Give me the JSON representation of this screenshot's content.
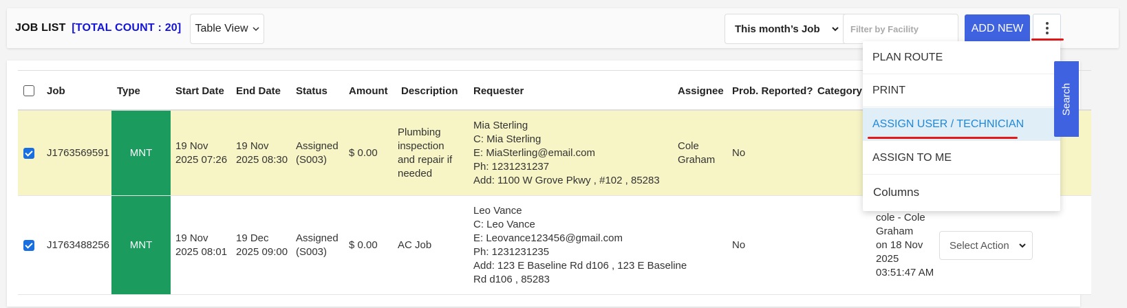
{
  "header": {
    "title": "JOB LIST",
    "count_label": "[TOTAL COUNT : 20]",
    "view_select": "Table View",
    "month_filter": "This month’s Job",
    "facility_placeholder": "Filter by Facility",
    "add_new": "ADD NEW"
  },
  "menu": {
    "items": [
      {
        "label": "PLAN ROUTE"
      },
      {
        "label": "PRINT"
      },
      {
        "label": "ASSIGN USER / TECHNICIAN"
      },
      {
        "label": "ASSIGN TO ME"
      },
      {
        "label": "Columns"
      }
    ]
  },
  "search_tab": "Search",
  "table": {
    "columns": [
      "Job",
      "Type",
      "Start Date",
      "End Date",
      "Status",
      "Amount",
      "Description",
      "Requester",
      "Assignee",
      "Prob. Reported?",
      "Category"
    ],
    "rows": [
      {
        "job": "J1763569591",
        "type": "MNT",
        "start": [
          "19 Nov",
          "2025 07:26"
        ],
        "end": [
          "19 Nov",
          "2025 08:30"
        ],
        "status": [
          "Assigned",
          "(S003)"
        ],
        "amount": "$ 0.00",
        "description": [
          "Plumbing",
          "inspection",
          "and repair if",
          "needed"
        ],
        "requester": [
          "Mia Sterling",
          "C: Mia Sterling",
          "E: MiaSterling@email.com",
          "Ph: 1231231237",
          "Add: 1100 W Grove Pkwy , #102 , 85283"
        ],
        "assignee": [
          "Cole",
          "Graham"
        ],
        "reported": "No"
      },
      {
        "job": "J1763488256",
        "type": "MNT",
        "start": [
          "19 Nov",
          "2025 08:01"
        ],
        "end": [
          "19 Dec",
          "2025 09:00"
        ],
        "status": [
          "Assigned",
          "(S003)"
        ],
        "amount": "$ 0.00",
        "description": [
          "AC Job"
        ],
        "requester": [
          "Leo Vance",
          "C: Leo Vance",
          "E: Leovance123456@gmail.com",
          "Ph: 1231231235",
          "Add: 123 E Baseline Rd d106 , 123 E Baseline",
          "Rd d106 , 85283"
        ],
        "assignee": [],
        "reported": "No",
        "assigned_info": [
          "cole - Cole",
          "Graham",
          "on 18 Nov",
          "2025",
          "03:51:47 AM"
        ],
        "action": "Select Action"
      }
    ]
  }
}
